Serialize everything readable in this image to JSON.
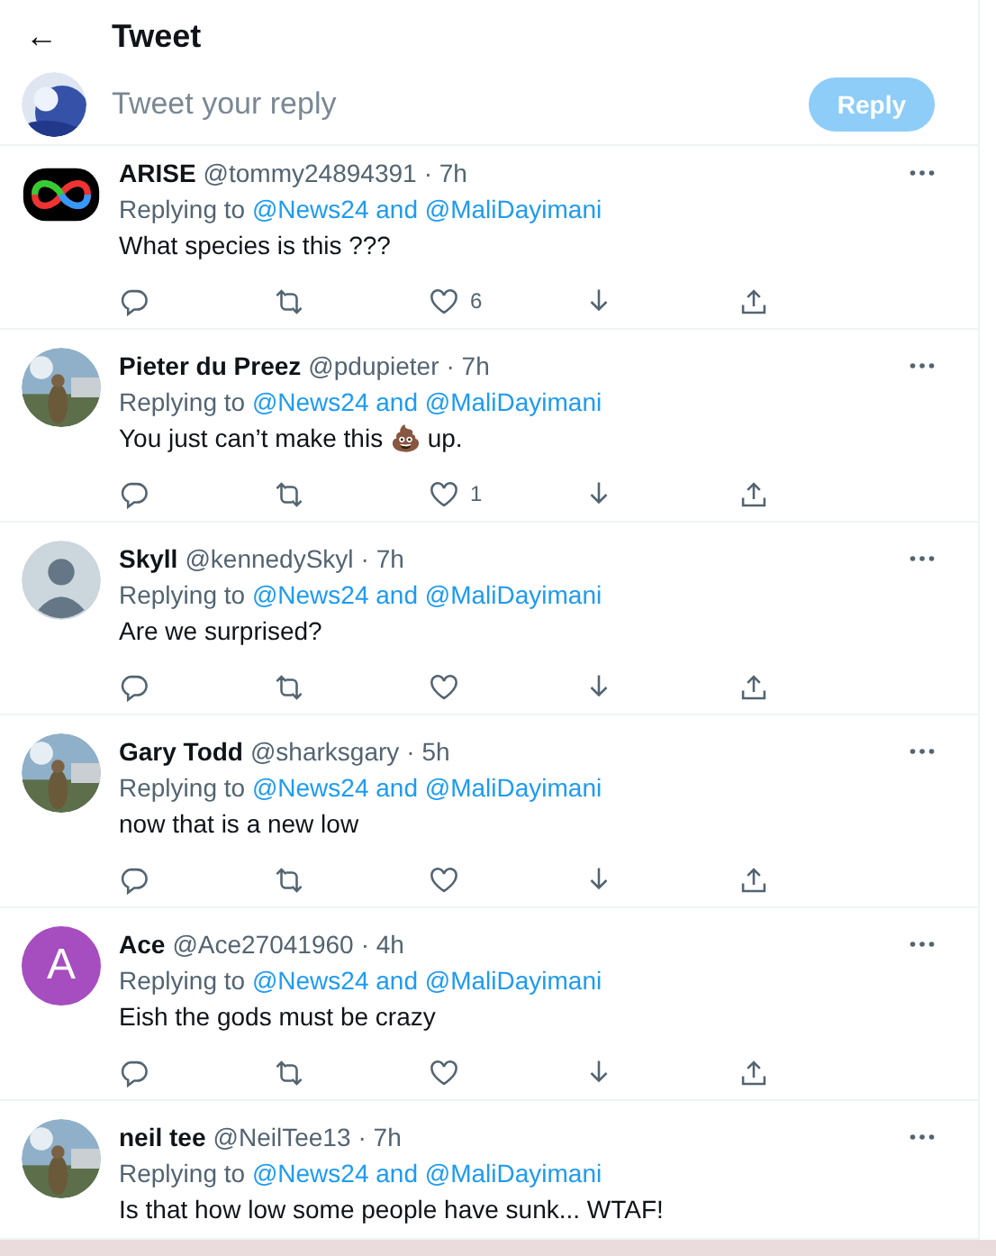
{
  "header": {
    "back": "←",
    "title": "Tweet"
  },
  "composer": {
    "placeholder": "Tweet your reply",
    "button": "Reply"
  },
  "tweets": [
    {
      "avatar": {
        "kind": "logo"
      },
      "name": "ARISE",
      "handle": "@tommy24894391",
      "time": "· 7h",
      "replying": "Replying to",
      "mentions": "@News24 and @MaliDayimani",
      "body": "What species is this ???",
      "likes": "6"
    },
    {
      "name": "Pieter du Preez",
      "handle": "@pdupieter",
      "time": "· 7h",
      "replying": "Replying to",
      "mentions": "@News24 and @MaliDayimani",
      "body": "You just can’t make this 💩 up.",
      "likes": "1"
    },
    {
      "avatar": {
        "kind": "default"
      },
      "name": "Skyll",
      "handle": "@kennedySkyl",
      "time": "· 7h",
      "replying": "Replying to",
      "mentions": "@News24 and @MaliDayimani",
      "body": "Are we surprised?"
    },
    {
      "name": "Gary Todd",
      "handle": "@sharksgary",
      "time": "· 5h",
      "replying": "Replying to",
      "mentions": "@News24 and @MaliDayimani",
      "body": "now that is a new low"
    },
    {
      "avatar": {
        "kind": "letter",
        "letter": "A",
        "color": "#a64dbf"
      },
      "name": "Ace",
      "handle": "@Ace27041960",
      "time": "· 4h",
      "replying": "Replying to",
      "mentions": "@News24 and @MaliDayimani",
      "body": "Eish the gods must be crazy"
    },
    {
      "name": "neil tee",
      "handle": "@NeilTee13",
      "time": "· 7h",
      "replying": "Replying to",
      "mentions": "@News24 and @MaliDayimani",
      "body": "Is that how low some people have sunk... WTAF!",
      "actions_visible": false
    }
  ]
}
